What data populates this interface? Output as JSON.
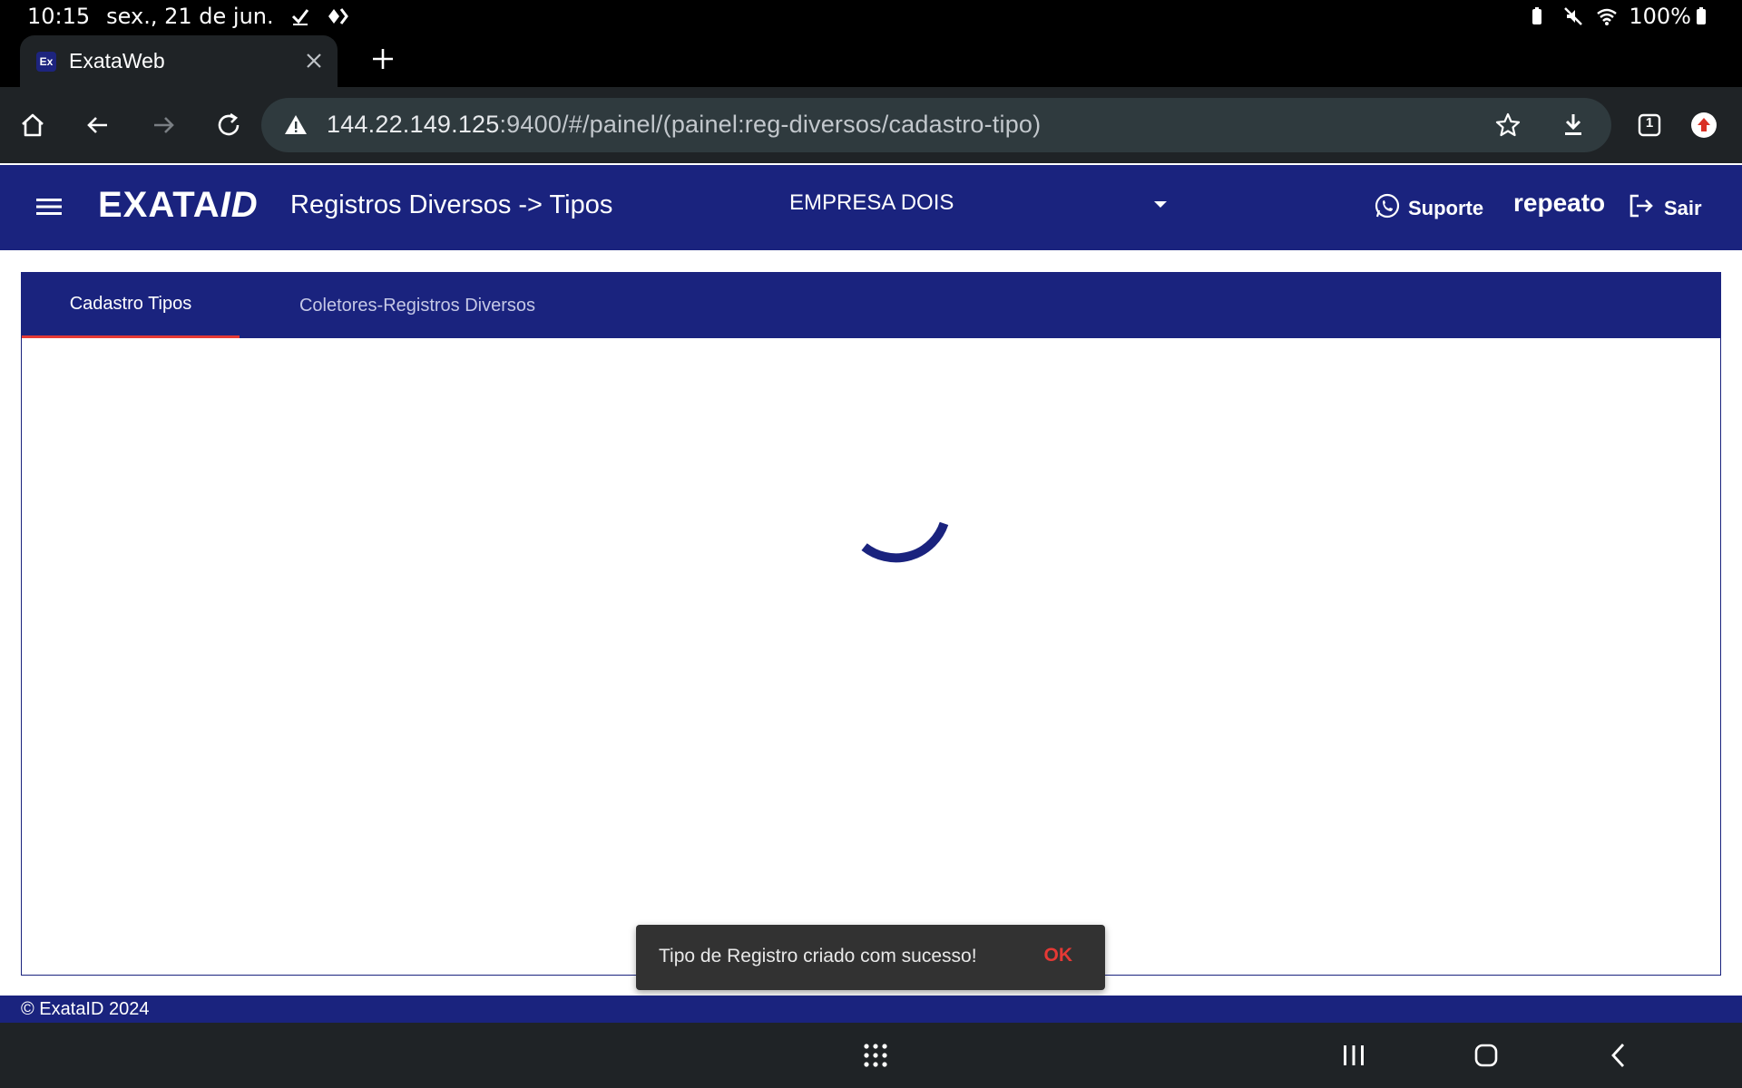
{
  "status_bar": {
    "time": "10:15",
    "date": "sex., 21 de jun.",
    "battery": "100%"
  },
  "browser": {
    "tab_title": "ExataWeb",
    "favicon_text": "Ex",
    "url_host": "144.22.149.125",
    "url_rest": ":9400/#/painel/(painel:reg-diversos/cadastro-tipo)",
    "tab_count": "1"
  },
  "header": {
    "logo_main": "EXATA",
    "logo_suffix": "ID",
    "title": "Registros Diversos -> Tipos",
    "company": "EMPRESA DOIS",
    "support_label": "Suporte",
    "username": "repeato",
    "logout_label": "Sair"
  },
  "tabs": [
    {
      "label": "Cadastro Tipos",
      "active": true
    },
    {
      "label": "Coletores-Registros Diversos",
      "active": false
    }
  ],
  "snackbar": {
    "message": "Tipo de Registro criado com sucesso!",
    "action": "OK"
  },
  "footer": {
    "text": "© ExataID 2024"
  },
  "colors": {
    "primary": "#1a237e",
    "accent": "#e53935",
    "browser_chrome": "#1f2326",
    "omnibox": "#2f3a3e"
  }
}
